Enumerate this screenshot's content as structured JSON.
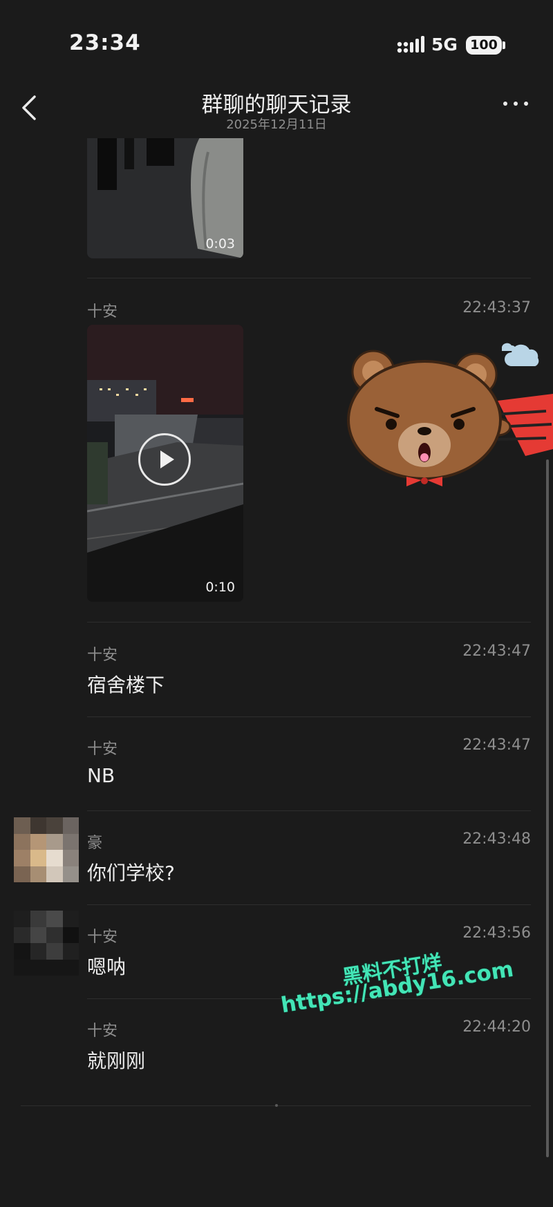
{
  "status_bar": {
    "time": "23:34",
    "network": "5G",
    "battery": "100"
  },
  "header": {
    "title": "群聊的聊天记录",
    "date": "2025年12月11日"
  },
  "messages": [
    {
      "video_duration": "0:03"
    },
    {
      "sender": "十安",
      "time": "22:43:37",
      "video_duration": "0:10"
    },
    {
      "sender": "十安",
      "time": "22:43:47",
      "text": "宿舍楼下"
    },
    {
      "sender": "十安",
      "time": "22:43:47",
      "text": "NB"
    },
    {
      "sender": "豪",
      "time": "22:43:48",
      "text": "你们学校?"
    },
    {
      "sender": "十安",
      "time": "22:43:56",
      "text": "嗯呐"
    },
    {
      "sender": "十安",
      "time": "22:44:20",
      "text": "就刚刚"
    }
  ],
  "watermark": {
    "line1": "黑料不打烊",
    "line2": "https://abdy16.com"
  },
  "colors": {
    "background": "#1b1b1b",
    "watermark": "#43e5b6",
    "bear": "#9a6137"
  },
  "icons": [
    "back-chevron-icon",
    "more-dots-icon",
    "signal-icon",
    "battery-icon",
    "play-icon",
    "bear-sticker"
  ]
}
